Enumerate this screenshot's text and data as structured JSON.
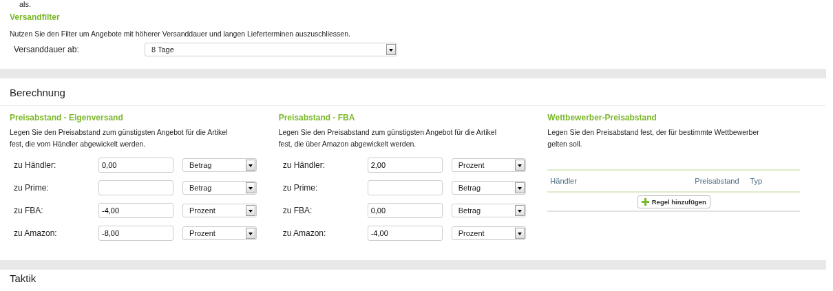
{
  "top_fragment": "als.",
  "versandfilter": {
    "title": "Versandfilter",
    "description": "Nutzen Sie den Filter um Angebote mit höherer Versanddauer und langen Lieferterminen auszuschliessen.",
    "label": "Versanddauer ab:",
    "value": "8 Tage"
  },
  "berechnung": {
    "title": "Berechnung",
    "groups": [
      {
        "title": "Preisabstand - Eigenversand",
        "description": "Legen Sie den Preisabstand zum günstigsten Angebot für die Artikel fest, die vom Händler abgewickelt werden.",
        "rows": [
          {
            "label": "zu Händler:",
            "value": "0,00",
            "type": "Betrag"
          },
          {
            "label": "zu Prime:",
            "type": "Betrag"
          },
          {
            "label": "zu FBA:",
            "value": "-4,00",
            "type": "Prozent"
          },
          {
            "label": "zu Amazon:",
            "value": "-8,00",
            "type": "Prozent"
          }
        ]
      },
      {
        "title": "Preisabstand - FBA",
        "description": "Legen Sie den Preisabstand zum günstigsten Angebot für die Artikel fest, die über Amazon abgewickelt werden.",
        "rows": [
          {
            "label": "zu Händler:",
            "value": "2,00",
            "type": "Prozent"
          },
          {
            "label": "zu Prime:",
            "type": "Betrag"
          },
          {
            "label": "zu FBA:",
            "value": "0,00",
            "type": "Betrag"
          },
          {
            "label": "zu Amazon:",
            "value": "-4,00",
            "type": "Prozent"
          }
        ]
      }
    ],
    "competitor": {
      "title": "Wettbewerber-Preisabstand",
      "description": "Legen Sie den Preisabstand fest, der für bestimmte Wettbewerber gelten soll.",
      "columns": [
        "Händler",
        "Preisabstand",
        "Typ"
      ],
      "add_button": "Regel hinzufügen"
    }
  },
  "next_section": {
    "title": "Taktik"
  }
}
